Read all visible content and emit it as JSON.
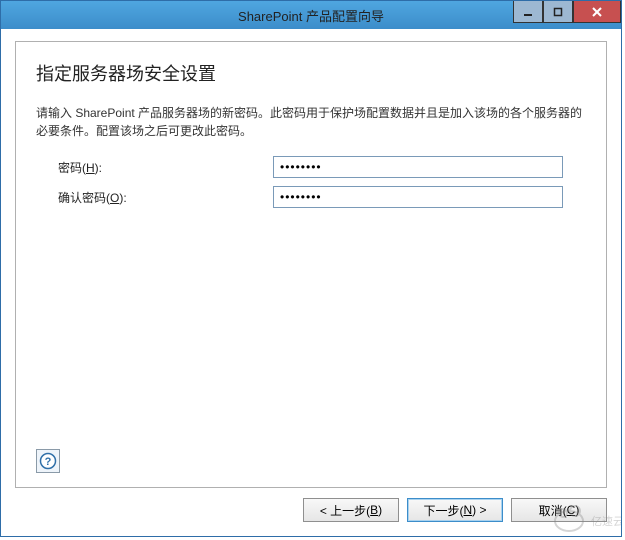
{
  "window": {
    "title": "SharePoint 产品配置向导"
  },
  "heading": "指定服务器场安全设置",
  "description": "请输入 SharePoint 产品服务器场的新密码。此密码用于保护场配置数据并且是加入该场的各个服务器的必要条件。配置该场之后可更改此密码。",
  "form": {
    "password": {
      "label_prefix": "密码(",
      "label_ak": "H",
      "label_suffix": "):",
      "value": "••••••••"
    },
    "confirm": {
      "label_prefix": "确认密码(",
      "label_ak": "O",
      "label_suffix": "):",
      "value": "••••••••"
    }
  },
  "buttons": {
    "back": {
      "prefix": "< 上一步(",
      "ak": "B",
      "suffix": ")"
    },
    "next": {
      "prefix": "下一步(",
      "ak": "N",
      "suffix": ") >"
    },
    "cancel": {
      "prefix": "取消(",
      "ak": "C",
      "suffix": ")"
    }
  },
  "watermark": "亿速云"
}
